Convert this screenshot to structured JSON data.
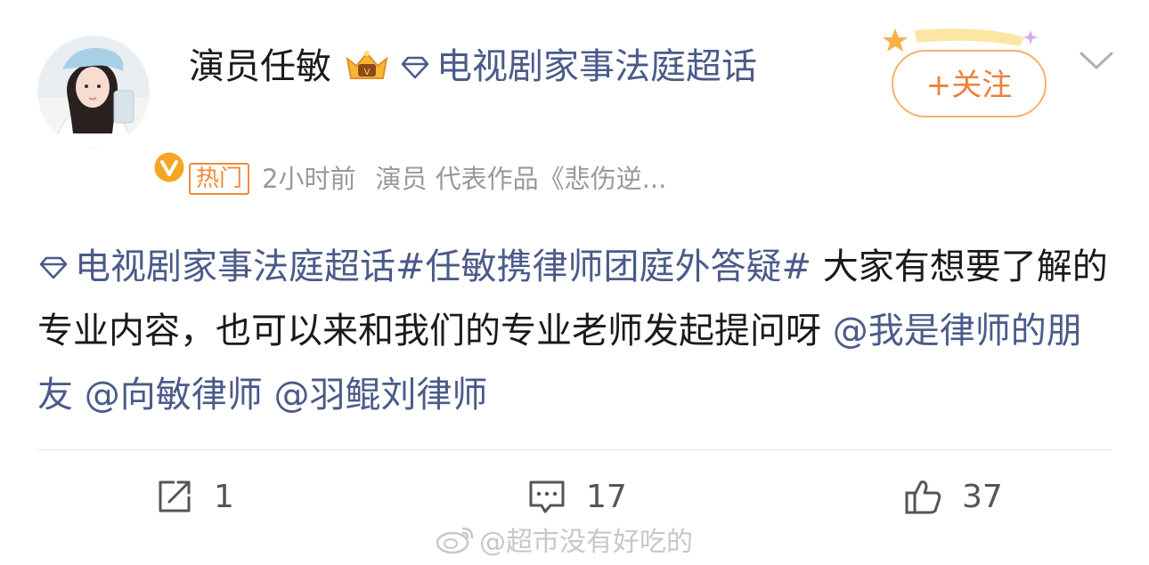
{
  "header": {
    "user_name": "演员任敏",
    "supertopic": "电视剧家事法庭超话",
    "hot_badge": "热门",
    "time": "2小时前",
    "source": "演员 代表作品《悲伤逆...",
    "follow_label": "+关注"
  },
  "post": {
    "supertopic_tag": "电视剧家事法庭超话",
    "hashtag": "#任敏携律师团庭外答疑#",
    "text": " 大家有想要了解的专业内容，也可以来和我们的专业老师发起提问呀 ",
    "mentions": [
      "@我是律师的朋友",
      "@向敏律师",
      "@羽鲲刘律师"
    ]
  },
  "actions": {
    "repost_count": "1",
    "comment_count": "17",
    "like_count": "37"
  },
  "watermark": "@超市没有好吃的",
  "colors": {
    "link": "#4a5a8a",
    "accent": "#f0803a",
    "hot": "#f08a3c",
    "verified": "#f5a623"
  },
  "icons": {
    "repost": "repost-icon",
    "comment": "comment-icon",
    "like": "thumbs-up-icon",
    "more": "chevron-down-icon",
    "supertopic": "diamond-icon",
    "membership": "crown-icon"
  }
}
